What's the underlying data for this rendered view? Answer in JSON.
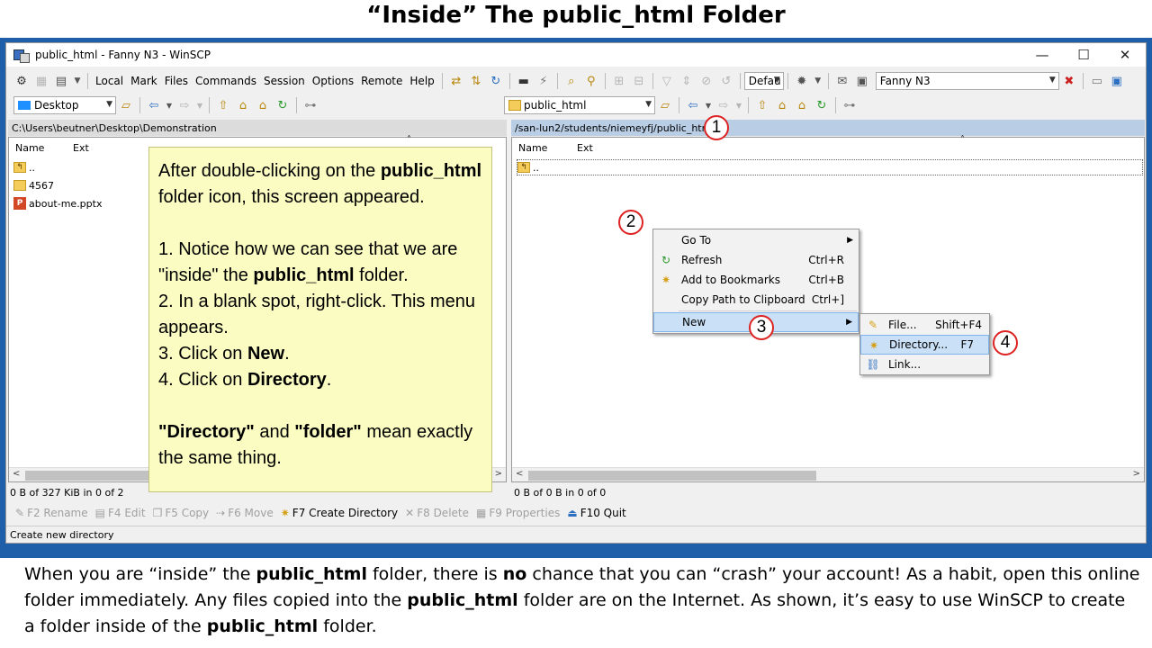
{
  "slide": {
    "title": "“Inside” The public_html Folder",
    "caption": {
      "p1": "When you are “inside” the ",
      "b1": "public_html",
      "p2": " folder, there is ",
      "b2": "no",
      "p3": " chance that you can “crash” your account! As a habit, open this online folder immediately. Any files copied into the ",
      "b3": "public_html",
      "p4": " folder are on the Internet. As shown, it’s easy to use WinSCP to create a folder inside of the ",
      "b4": "public_html",
      "p5": " folder."
    }
  },
  "window": {
    "title": "public_html - Fanny N3 - WinSCP",
    "minimize": "—",
    "maximize": "☐",
    "close": "✕"
  },
  "menu": [
    "Local",
    "Mark",
    "Files",
    "Commands",
    "Session",
    "Options",
    "Remote",
    "Help"
  ],
  "toolbar": {
    "transfer_combo": "Defau",
    "session_combo": "Fanny N3"
  },
  "left": {
    "location_combo": "Desktop",
    "path": "C:\\Users\\beutner\\Desktop\\Demonstration",
    "col_name": "Name",
    "col_ext": "Ext",
    "files": [
      {
        "name": "..",
        "kind": "up"
      },
      {
        "name": "4567",
        "kind": "folder"
      },
      {
        "name": "about-me.pptx",
        "kind": "pptx"
      }
    ],
    "status": "0 B of 327 KiB in 0 of 2"
  },
  "right": {
    "location_combo": "public_html",
    "path": "/san-lun2/students/niemeyfj/public_html",
    "col_name": "Name",
    "col_ext": "Ext",
    "files": [
      {
        "name": "..",
        "kind": "up"
      }
    ],
    "status": "0 B of 0 B in 0 of 0"
  },
  "note": {
    "l1a": "After double-clicking on the ",
    "l1b": "public_html",
    "l1c": " folder icon, this screen appeared.",
    "s1a": "1. Notice how we can see that we are \"inside\" the ",
    "s1b": "public_html",
    "s1c": " folder.",
    "s2": "2. In a blank spot, right-click. This menu appears.",
    "s3a": "3. Click on ",
    "s3b": "New",
    "s3c": ".",
    "s4a": "4. Click on ",
    "s4b": "Directory",
    "s4c": ".",
    "f1": "\"Directory\"",
    "f2": " and ",
    "f3": "\"folder\"",
    "f4": " mean exactly the same thing."
  },
  "context_menu": {
    "items": [
      {
        "label": "Go To",
        "shortcut": "",
        "submenu": true
      },
      {
        "label": "Refresh",
        "shortcut": "Ctrl+R"
      },
      {
        "label": "Add to Bookmarks",
        "shortcut": "Ctrl+B"
      },
      {
        "label": "Copy Path to Clipboard",
        "shortcut": "Ctrl+]"
      },
      {
        "label": "New",
        "shortcut": "",
        "submenu": true
      }
    ],
    "submenu": [
      {
        "label": "File...",
        "shortcut": "Shift+F4"
      },
      {
        "label": "Directory...",
        "shortcut": "F7"
      },
      {
        "label": "Link...",
        "shortcut": ""
      }
    ]
  },
  "callouts": [
    "1",
    "2",
    "3",
    "4"
  ],
  "fkeys": [
    {
      "label": "F2 Rename",
      "enabled": false
    },
    {
      "label": "F4 Edit",
      "enabled": false
    },
    {
      "label": "F5 Copy",
      "enabled": false
    },
    {
      "label": "F6 Move",
      "enabled": false
    },
    {
      "label": "F7 Create Directory",
      "enabled": true
    },
    {
      "label": "F8 Delete",
      "enabled": false
    },
    {
      "label": "F9 Properties",
      "enabled": false
    },
    {
      "label": "F10 Quit",
      "enabled": true
    }
  ],
  "bottom_status": "Create new directory"
}
